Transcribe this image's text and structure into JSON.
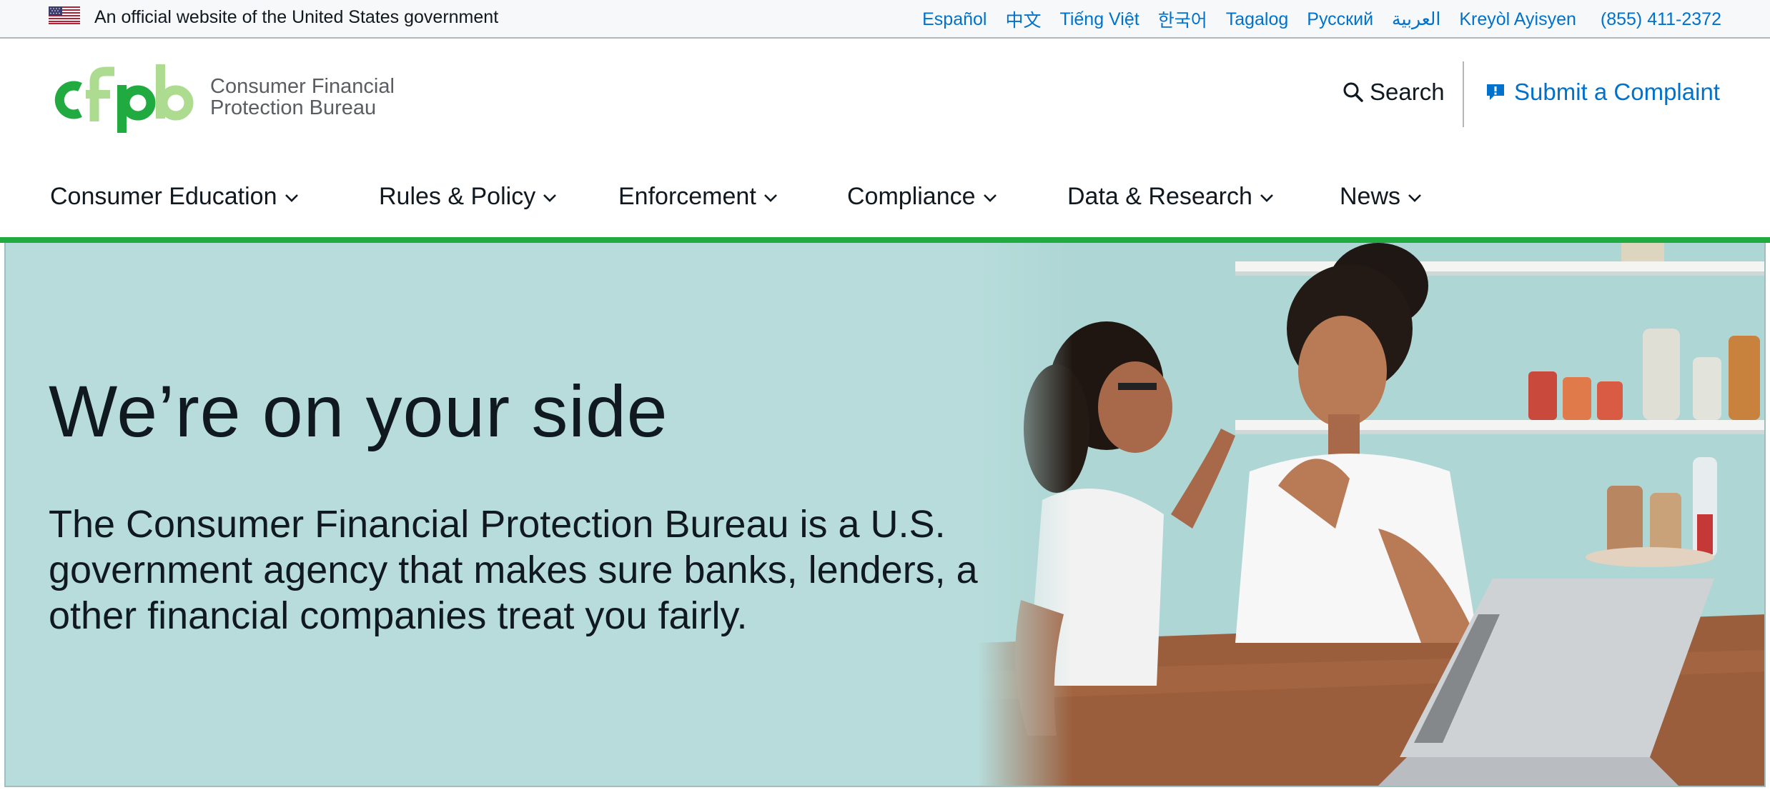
{
  "gov_banner": {
    "text": "An official website of the United States government",
    "languages": [
      "Español",
      "中文",
      "Tiếng Việt",
      "한국어",
      "Tagalog",
      "Русский",
      "العربية",
      "Kreyòl Ayisyen"
    ],
    "phone": "(855) 411-2372"
  },
  "header": {
    "logo_mark": "cfpb",
    "logo_text_line1": "Consumer Financial",
    "logo_text_line2": "Protection Bureau",
    "search_label": "Search",
    "search_icon": "search-icon",
    "complaint_label": "Submit a Complaint",
    "complaint_icon": "complaint-icon"
  },
  "nav": {
    "items": [
      "Consumer Education",
      "Rules & Policy",
      "Enforcement",
      "Compliance",
      "Data & Research",
      "News"
    ]
  },
  "hero": {
    "title": "We’re on your side",
    "description": "The Consumer Financial Protection Bureau is a U.S. government agency that makes sure banks, lenders, and other financial companies treat you fairly."
  },
  "colors": {
    "brand_green": "#20aa3f",
    "light_green": "#addc91",
    "link_blue": "#0072ce",
    "hero_background": "#b7dcdb",
    "text_dark": "#101820"
  }
}
